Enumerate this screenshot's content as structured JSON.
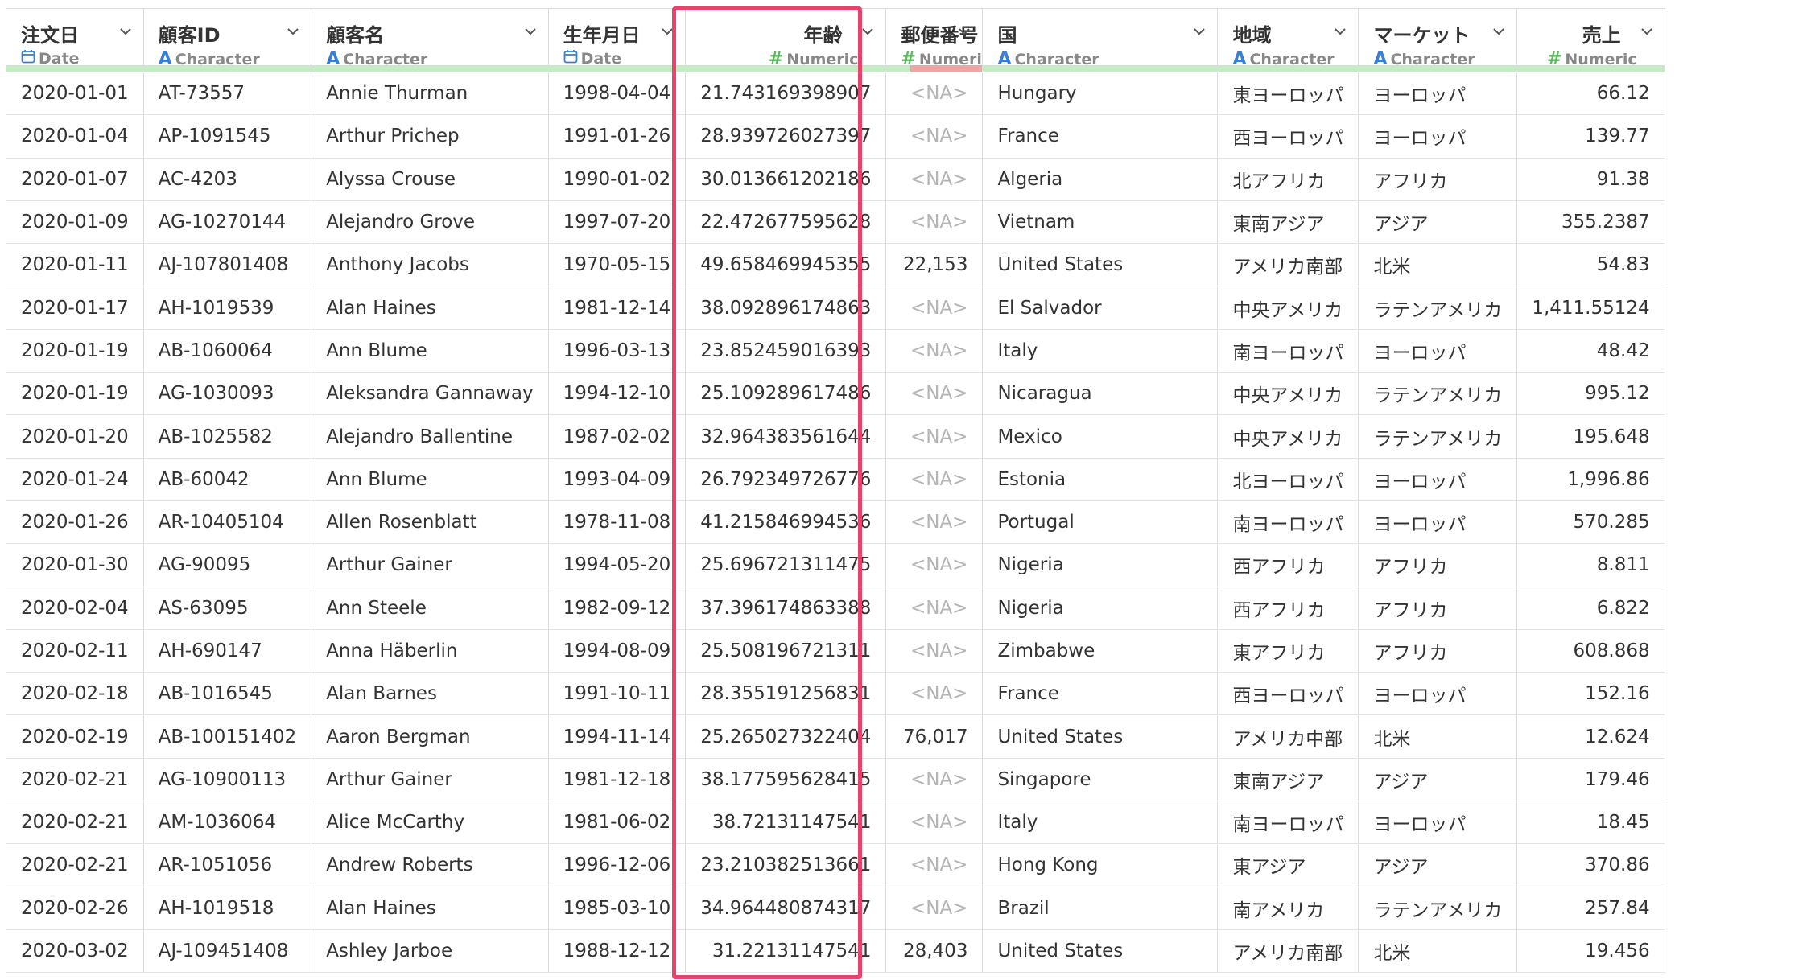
{
  "columns": [
    {
      "name": "注文日",
      "type": "Date",
      "icon": "calendar-icon",
      "align": "left"
    },
    {
      "name": "顧客ID",
      "type": "Character",
      "icon": "character-icon",
      "align": "left"
    },
    {
      "name": "顧客名",
      "type": "Character",
      "icon": "character-icon",
      "align": "left"
    },
    {
      "name": "生年月日",
      "type": "Date",
      "icon": "calendar-icon",
      "align": "left"
    },
    {
      "name": "年齢",
      "type": "Numeric",
      "icon": "numeric-icon",
      "align": "right"
    },
    {
      "name": "郵便番号",
      "type": "Numeric",
      "icon": "numeric-icon",
      "align": "left"
    },
    {
      "name": "国",
      "type": "Character",
      "icon": "character-icon",
      "align": "left"
    },
    {
      "name": "地域",
      "type": "Character",
      "icon": "character-icon",
      "align": "left"
    },
    {
      "name": "マーケット",
      "type": "Character",
      "icon": "character-icon",
      "align": "left"
    },
    {
      "name": "売上",
      "type": "Numeric",
      "icon": "numeric-icon",
      "align": "right"
    }
  ],
  "rows": [
    [
      "2020-01-01",
      "AT-73557",
      "Annie Thurman",
      "1998-04-04",
      "21.743169398907",
      "<NA>",
      "Hungary",
      "東ヨーロッパ",
      "ヨーロッパ",
      "66.12"
    ],
    [
      "2020-01-04",
      "AP-1091545",
      "Arthur Prichep",
      "1991-01-26",
      "28.939726027397",
      "<NA>",
      "France",
      "西ヨーロッパ",
      "ヨーロッパ",
      "139.77"
    ],
    [
      "2020-01-07",
      "AC-4203",
      "Alyssa Crouse",
      "1990-01-02",
      "30.013661202186",
      "<NA>",
      "Algeria",
      "北アフリカ",
      "アフリカ",
      "91.38"
    ],
    [
      "2020-01-09",
      "AG-10270144",
      "Alejandro Grove",
      "1997-07-20",
      "22.472677595628",
      "<NA>",
      "Vietnam",
      "東南アジア",
      "アジア",
      "355.2387"
    ],
    [
      "2020-01-11",
      "AJ-107801408",
      "Anthony Jacobs",
      "1970-05-15",
      "49.658469945355",
      "22,153",
      "United States",
      "アメリカ南部",
      "北米",
      "54.83"
    ],
    [
      "2020-01-17",
      "AH-1019539",
      "Alan Haines",
      "1981-12-14",
      "38.092896174863",
      "<NA>",
      "El Salvador",
      "中央アメリカ",
      "ラテンアメリカ",
      "1,411.55124"
    ],
    [
      "2020-01-19",
      "AB-1060064",
      "Ann Blume",
      "1996-03-13",
      "23.852459016393",
      "<NA>",
      "Italy",
      "南ヨーロッパ",
      "ヨーロッパ",
      "48.42"
    ],
    [
      "2020-01-19",
      "AG-1030093",
      "Aleksandra Gannaway",
      "1994-12-10",
      "25.109289617486",
      "<NA>",
      "Nicaragua",
      "中央アメリカ",
      "ラテンアメリカ",
      "995.12"
    ],
    [
      "2020-01-20",
      "AB-1025582",
      "Alejandro Ballentine",
      "1987-02-02",
      "32.964383561644",
      "<NA>",
      "Mexico",
      "中央アメリカ",
      "ラテンアメリカ",
      "195.648"
    ],
    [
      "2020-01-24",
      "AB-60042",
      "Ann Blume",
      "1993-04-09",
      "26.792349726776",
      "<NA>",
      "Estonia",
      "北ヨーロッパ",
      "ヨーロッパ",
      "1,996.86"
    ],
    [
      "2020-01-26",
      "AR-10405104",
      "Allen Rosenblatt",
      "1978-11-08",
      "41.215846994536",
      "<NA>",
      "Portugal",
      "南ヨーロッパ",
      "ヨーロッパ",
      "570.285"
    ],
    [
      "2020-01-30",
      "AG-90095",
      "Arthur Gainer",
      "1994-05-20",
      "25.696721311475",
      "<NA>",
      "Nigeria",
      "西アフリカ",
      "アフリカ",
      "8.811"
    ],
    [
      "2020-02-04",
      "AS-63095",
      "Ann Steele",
      "1982-09-12",
      "37.396174863388",
      "<NA>",
      "Nigeria",
      "西アフリカ",
      "アフリカ",
      "6.822"
    ],
    [
      "2020-02-11",
      "AH-690147",
      "Anna Häberlin",
      "1994-08-09",
      "25.508196721311",
      "<NA>",
      "Zimbabwe",
      "東アフリカ",
      "アフリカ",
      "608.868"
    ],
    [
      "2020-02-18",
      "AB-1016545",
      "Alan Barnes",
      "1991-10-11",
      "28.355191256831",
      "<NA>",
      "France",
      "西ヨーロッパ",
      "ヨーロッパ",
      "152.16"
    ],
    [
      "2020-02-19",
      "AB-100151402",
      "Aaron Bergman",
      "1994-11-14",
      "25.265027322404",
      "76,017",
      "United States",
      "アメリカ中部",
      "北米",
      "12.624"
    ],
    [
      "2020-02-21",
      "AG-10900113",
      "Arthur Gainer",
      "1981-12-18",
      "38.177595628415",
      "<NA>",
      "Singapore",
      "東南アジア",
      "アジア",
      "179.46"
    ],
    [
      "2020-02-21",
      "AM-1036064",
      "Alice McCarthy",
      "1981-06-02",
      "38.72131147541",
      "<NA>",
      "Italy",
      "南ヨーロッパ",
      "ヨーロッパ",
      "18.45"
    ],
    [
      "2020-02-21",
      "AR-1051056",
      "Andrew Roberts",
      "1996-12-06",
      "23.210382513661",
      "<NA>",
      "Hong Kong",
      "東アジア",
      "アジア",
      "370.86"
    ],
    [
      "2020-02-26",
      "AH-1019518",
      "Alan Haines",
      "1985-03-10",
      "34.964480874317",
      "<NA>",
      "Brazil",
      "南アメリカ",
      "ラテンアメリカ",
      "257.84"
    ],
    [
      "2020-03-02",
      "AJ-109451408",
      "Ashley Jarboe",
      "1988-12-12",
      "31.22131147541",
      "28,403",
      "United States",
      "アメリカ南部",
      "北米",
      "19.456"
    ]
  ],
  "colors": {
    "highlight_border": "#e8436e",
    "quality_bar_valid": "#c3ecc3",
    "quality_bar_missing": "#eea6a3",
    "character_icon": "#3a7fd5",
    "numeric_icon": "#5cb85c"
  }
}
